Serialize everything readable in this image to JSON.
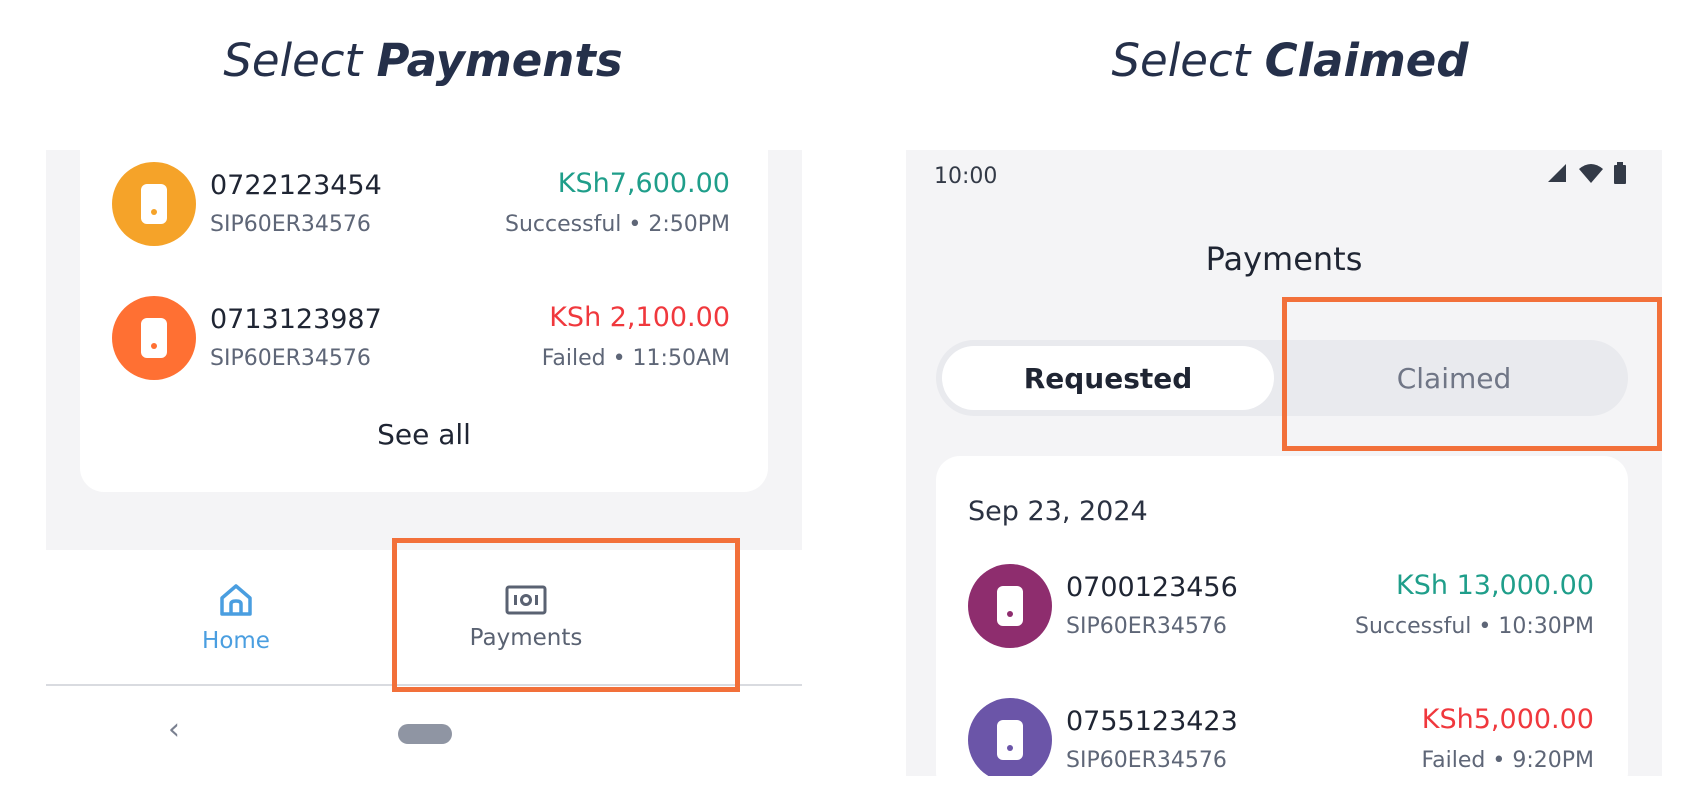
{
  "headings": {
    "left_prefix": "Select",
    "left_emphasis": "Payments",
    "right_prefix": "Select",
    "right_emphasis": "Claimed"
  },
  "left_screen": {
    "transactions": [
      {
        "number": "0722123454",
        "ref": "SIP60ER34576",
        "amount": "KSh7,600.00",
        "status": "Successful • 2:50PM",
        "state": "successful",
        "avatar_color": "#f5a329"
      },
      {
        "number": "0713123987",
        "ref": "SIP60ER34576",
        "amount": "KSh 2,100.00",
        "status": "Failed  • 11:50AM",
        "state": "failed",
        "avatar_color": "#ff7033"
      }
    ],
    "see_all": "See all",
    "bottom_nav": {
      "home_label": "Home",
      "home_icon": "home-icon",
      "payments_label": "Payments",
      "payments_icon": "cash-icon"
    },
    "system_nav": {
      "back_icon": "back-chevron-icon",
      "home_icon": "home-pill-icon"
    }
  },
  "right_screen": {
    "status_bar": {
      "time": "10:00",
      "icons": [
        "signal-icon",
        "wifi-icon",
        "battery-icon"
      ]
    },
    "title": "Payments",
    "tabs": [
      {
        "label": "Requested",
        "selected": true
      },
      {
        "label": "Claimed",
        "selected": false
      }
    ],
    "date": "Sep 23, 2024",
    "transactions": [
      {
        "number": "0700123456",
        "ref": "SIP60ER34576",
        "amount": "KSh 13,000.00",
        "status": "Successful • 10:30PM",
        "state": "successful",
        "avatar_color": "#8e2d6e"
      },
      {
        "number": "0755123423",
        "ref": "SIP60ER34576",
        "amount": "KSh5,000.00",
        "status": "Failed • 9:20PM",
        "state": "failed",
        "avatar_color": "#6b55a8"
      }
    ]
  },
  "colors": {
    "highlight": "#f2703a",
    "success": "#1f9e8a",
    "failed": "#f0383d",
    "home_active": "#4a9ee0"
  }
}
